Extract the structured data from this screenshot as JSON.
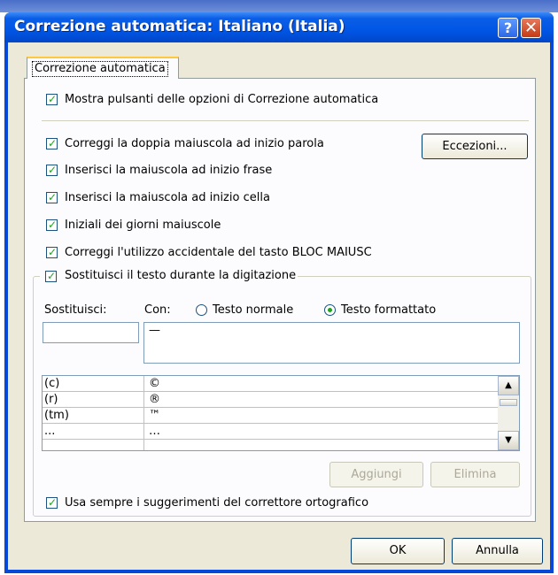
{
  "window": {
    "title": "Correzione automatica: Italiano (Italia)",
    "help_glyph": "?",
    "close_glyph": "✕"
  },
  "tabs": [
    {
      "label": "Correzione automatica",
      "selected": true
    }
  ],
  "options": {
    "show_buttons": {
      "label": "Mostra pulsanti delle opzioni di Correzione automatica",
      "checked": true
    },
    "double_caps": {
      "label": "Correggi la doppia maiuscola ad inizio parola",
      "checked": true
    },
    "sentence_caps": {
      "label": "Inserisci la maiuscola ad inizio frase",
      "checked": true
    },
    "cell_caps": {
      "label": "Inserisci la maiuscola ad inizio cella",
      "checked": true
    },
    "day_names": {
      "label": "Iniziali dei giorni maiuscole",
      "checked": true
    },
    "caps_lock": {
      "label": "Correggi l'utilizzo accidentale del tasto BLOC MAIUSC",
      "checked": true
    },
    "replace_text": {
      "label": "Sostituisci il testo durante la digitazione",
      "checked": true
    },
    "use_spell_suggestions": {
      "label": "Usa sempre i suggerimenti del correttore ortografico",
      "checked": true
    }
  },
  "buttons": {
    "exceptions": "Eccezioni...",
    "add": "Aggiungi",
    "delete": "Elimina",
    "ok": "OK",
    "cancel": "Annulla"
  },
  "replace": {
    "replace_label": "Sostituisci:",
    "with_label": "Con:",
    "plain_text_label": "Testo normale",
    "formatted_text_label": "Testo formattato",
    "selected_mode": "formatted",
    "replace_value": "",
    "with_value": "—"
  },
  "entries": [
    {
      "replace": "(c)",
      "with": "©"
    },
    {
      "replace": "(r)",
      "with": "®"
    },
    {
      "replace": "(tm)",
      "with": "™"
    },
    {
      "replace": "...",
      "with": "…"
    }
  ],
  "colors": {
    "title_bar": "#0055e5",
    "dialog_face": "#ece9d8",
    "check_mark": "#21a121",
    "tab_highlight": "#ffc83c"
  }
}
